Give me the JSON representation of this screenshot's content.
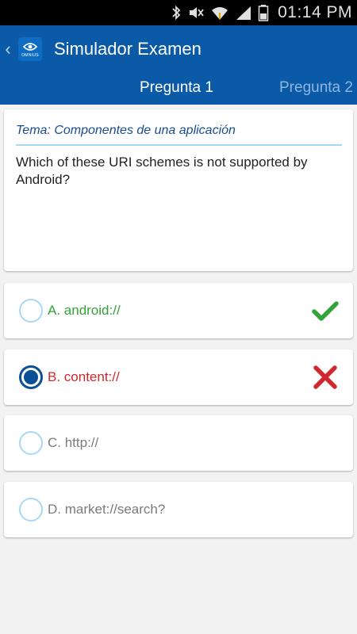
{
  "status_bar": {
    "time": "01:14 PM",
    "icons": [
      "bluetooth-icon",
      "mute-icon",
      "wifi-icon",
      "signal-icon",
      "battery-icon"
    ]
  },
  "app_bar": {
    "back_icon": "chevron-left-icon",
    "logo_icon": "eye-logo-icon",
    "logo_text": "OMNIUS",
    "title": "Simulador Examen"
  },
  "tabs": [
    {
      "label": "Pregunta 1",
      "active": true
    },
    {
      "label": "Pregunta 2",
      "active": false
    }
  ],
  "question": {
    "topic": "Tema: Componentes de una aplicación",
    "text": "Which of these URI schemes is not supported by Android?"
  },
  "options": [
    {
      "label": "A. android://",
      "state": "correct",
      "selected": false,
      "result_icon": "checkmark-icon"
    },
    {
      "label": "B. content://",
      "state": "wrong",
      "selected": true,
      "result_icon": "cross-icon"
    },
    {
      "label": "C. http://",
      "state": "neutral",
      "selected": false
    },
    {
      "label": "D. market://search?",
      "state": "neutral",
      "selected": false
    }
  ],
  "colors": {
    "primary": "#0b5aa7",
    "correct": "#35a33a",
    "wrong": "#d0282c",
    "radio_border": "#aad8f4"
  }
}
